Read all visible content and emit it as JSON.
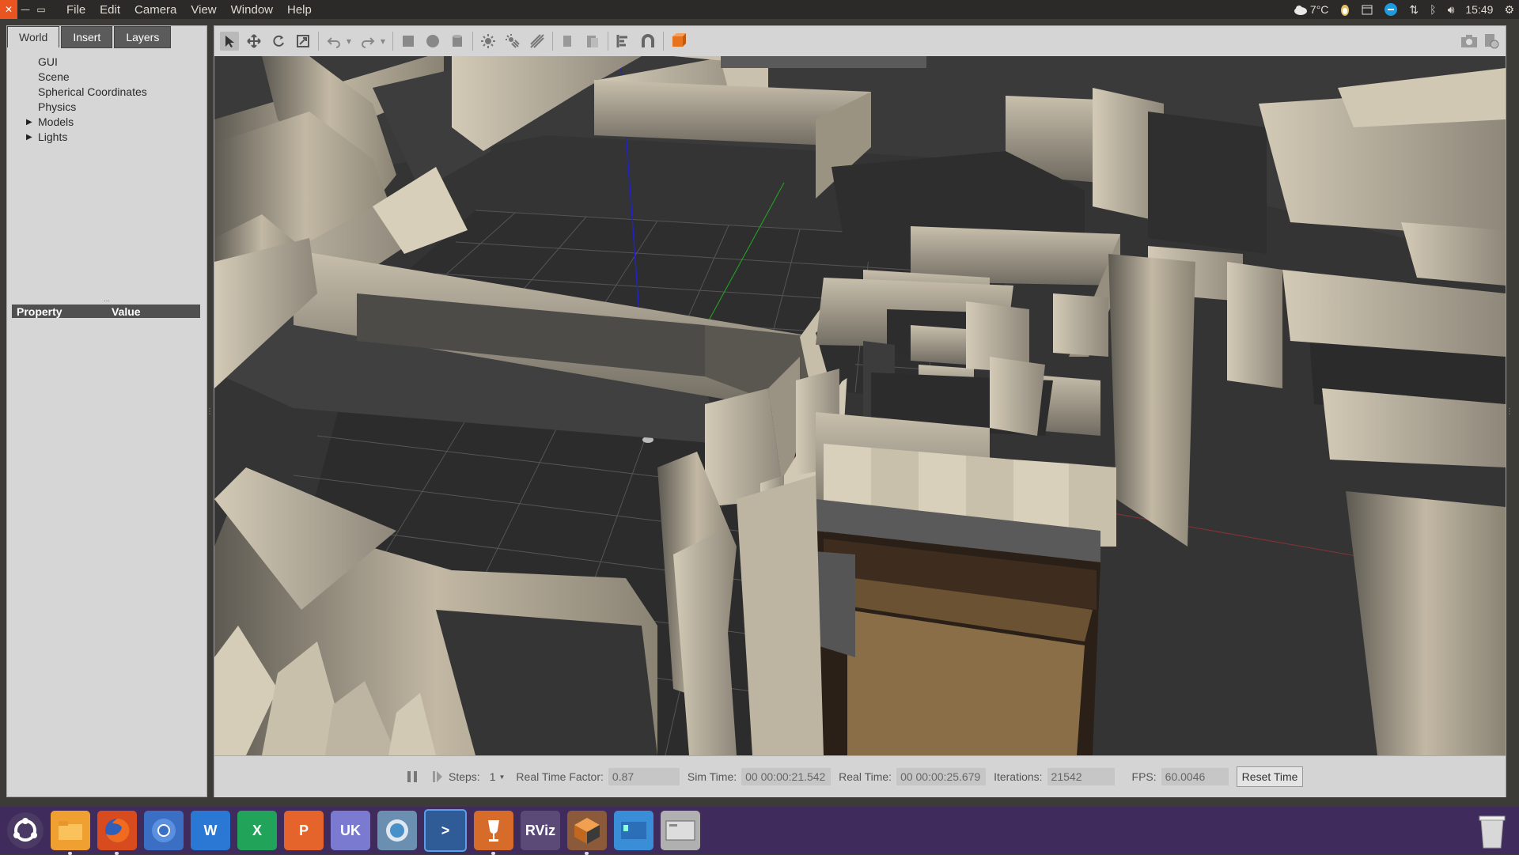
{
  "top_panel": {
    "menu": [
      "File",
      "Edit",
      "Camera",
      "View",
      "Window",
      "Help"
    ],
    "weather": "7°C",
    "clock": "15:49"
  },
  "left_panel": {
    "tabs": [
      "World",
      "Insert",
      "Layers"
    ],
    "active_tab": "World",
    "tree": [
      {
        "label": "GUI",
        "expandable": false
      },
      {
        "label": "Scene",
        "expandable": false
      },
      {
        "label": "Spherical Coordinates",
        "expandable": false
      },
      {
        "label": "Physics",
        "expandable": false
      },
      {
        "label": "Models",
        "expandable": true
      },
      {
        "label": "Lights",
        "expandable": true
      }
    ],
    "property_header": {
      "property": "Property",
      "value": "Value"
    }
  },
  "toolbar": {
    "icons": [
      "select-arrow-icon",
      "translate-icon",
      "rotate-icon",
      "scale-icon",
      "undo-icon",
      "redo-icon",
      "box-shape-icon",
      "sphere-shape-icon",
      "cylinder-shape-icon",
      "point-light-icon",
      "spot-light-icon",
      "directional-light-icon",
      "copy-icon",
      "paste-icon",
      "align-icon",
      "snap-icon",
      "view-angle-icon"
    ],
    "right_icons": [
      "screenshot-icon",
      "log-icon"
    ]
  },
  "bottom_bar": {
    "steps_label": "Steps:",
    "steps_value": "1",
    "rtf_label": "Real Time Factor:",
    "rtf_value": "0.87",
    "sim_label": "Sim Time:",
    "sim_value": "00 00:00:21.542",
    "real_label": "Real Time:",
    "real_value": "00 00:00:25.679",
    "iter_label": "Iterations:",
    "iter_value": "21542",
    "fps_label": "FPS:",
    "fps_value": "60.0046",
    "reset_label": "Reset Time"
  },
  "taskbar": {
    "apps": [
      {
        "name": "ubuntu-dash-icon",
        "text": "",
        "color": "#4b3a63"
      },
      {
        "name": "files-icon",
        "text": "",
        "color": "#f0a030"
      },
      {
        "name": "firefox-icon",
        "text": "",
        "color": "#d84b1e"
      },
      {
        "name": "chromium-icon",
        "text": "",
        "color": "#3a6fc4"
      },
      {
        "name": "word-icon",
        "text": "W",
        "color": "#2b78d4"
      },
      {
        "name": "excel-icon",
        "text": "X",
        "color": "#21a35a"
      },
      {
        "name": "powerpoint-icon",
        "text": "P",
        "color": "#e5642b"
      },
      {
        "name": "language-uk-icon",
        "text": "UK",
        "color": "#7a7bd0"
      },
      {
        "name": "software-updater-icon",
        "text": "",
        "color": "#6b8fb0"
      },
      {
        "name": "vscode-icon",
        "text": ">",
        "color": "#2f5c96"
      },
      {
        "name": "wine-icon",
        "text": "",
        "color": "#d76b2a"
      },
      {
        "name": "rviz-icon",
        "text": "RViz",
        "color": "#5b4a78"
      },
      {
        "name": "gazebo-icon",
        "text": "",
        "color": "#c07020"
      },
      {
        "name": "workspace-switcher-icon",
        "text": "",
        "color": "#3a8ed8"
      },
      {
        "name": "disk-icon",
        "text": "",
        "color": "#b0b0b0"
      }
    ]
  }
}
